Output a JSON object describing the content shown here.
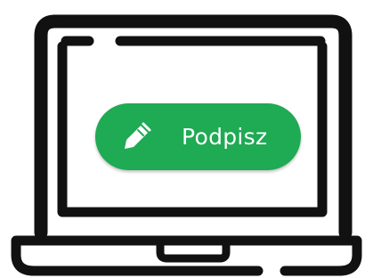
{
  "illustration": {
    "icon": "laptop-icon",
    "outline_color": "#111111",
    "screen_color": "#ffffff"
  },
  "sign_button": {
    "label": "Podpisz",
    "icon": "pen-icon",
    "background_color": "#1faa54",
    "text_color": "#ffffff"
  }
}
